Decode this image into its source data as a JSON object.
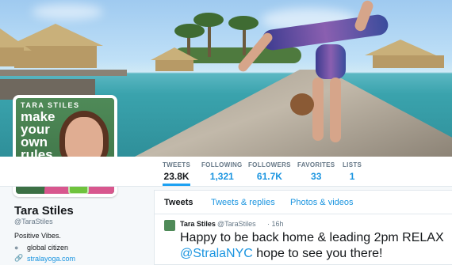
{
  "profile": {
    "avatar_brand": "TARA STILES",
    "avatar_book": "make your own rules diet",
    "name": "Tara Stiles",
    "handle": "@TaraStiles",
    "bio": "Positive Vibes.",
    "location": "global citizen",
    "website": "stralayoga.com"
  },
  "stats": [
    {
      "label": "TWEETS",
      "value": "23.8K"
    },
    {
      "label": "FOLLOWING",
      "value": "1,321"
    },
    {
      "label": "FOLLOWERS",
      "value": "61.7K"
    },
    {
      "label": "FAVORITES",
      "value": "33"
    },
    {
      "label": "LISTS",
      "value": "1"
    }
  ],
  "tabs": [
    "Tweets",
    "Tweets & replies",
    "Photos & videos"
  ],
  "tweet": {
    "author": "Tara Stiles",
    "handle": "@TaraStiles",
    "time": "· 16h",
    "text_before": "Happy to be back home & leading 2pm RELAX ",
    "mention": "@StralaNYC",
    "text_after": " hope to see you there!"
  },
  "icons": {
    "location": "location-pin-icon",
    "website": "link-icon"
  },
  "colors": {
    "link": "#1b95e0",
    "accent": "#1da1f2",
    "muted": "#657786"
  }
}
